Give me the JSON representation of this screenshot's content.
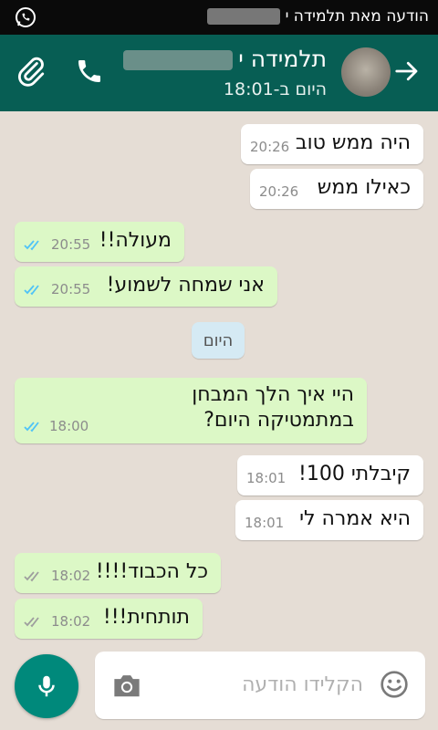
{
  "status_bar": {
    "notification": "הודעה מאת תלמידה י"
  },
  "header": {
    "contact_name": "תלמידה י",
    "last_seen": "היום ב-18:01"
  },
  "messages": [
    {
      "text": "היה ממש טוב",
      "time": "20:26"
    },
    {
      "text": "כאילו ממש",
      "time": "20:26"
    },
    {
      "text": "מעולה!!",
      "time": "20:55"
    },
    {
      "text": "אני שמחה לשמוע!",
      "time": "20:55"
    },
    {
      "text_line1": "היי איך הלך המבחן",
      "text_line2": "במתמטיקה היום?",
      "time": "18:00"
    },
    {
      "text": "קיבלתי 100!",
      "time": "18:01"
    },
    {
      "text": "היא אמרה לי",
      "time": "18:01"
    },
    {
      "text": "כל הכבוד!!!!",
      "time": "18:02"
    },
    {
      "text": "תותחית!!!",
      "time": "18:02"
    }
  ],
  "day_divider": "היום",
  "composer": {
    "placeholder": "הקלידו הודעה"
  },
  "colors": {
    "header": "#075e54",
    "outgoing_bubble": "#dcf8c6",
    "incoming_bubble": "#ffffff",
    "mic_button": "#00897b",
    "read_ticks": "#4fc3f7",
    "delivered_ticks": "#9e9e9e"
  }
}
